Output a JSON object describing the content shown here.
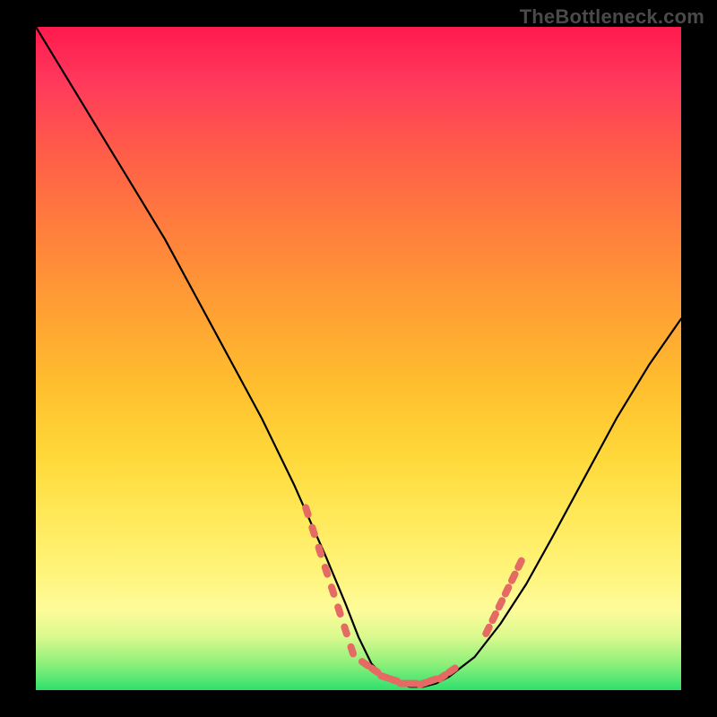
{
  "watermark": "TheBottleneck.com",
  "chart_data": {
    "type": "line",
    "title": "",
    "xlabel": "",
    "ylabel": "",
    "xlim": [
      0,
      100
    ],
    "ylim": [
      0,
      100
    ],
    "grid": false,
    "legend": false,
    "series": [
      {
        "name": "bottleneck-curve",
        "color": "#000000",
        "x": [
          0,
          5,
          10,
          15,
          20,
          25,
          30,
          35,
          40,
          45,
          48,
          50,
          52,
          54,
          56,
          58,
          60,
          62,
          64,
          68,
          72,
          76,
          80,
          85,
          90,
          95,
          100
        ],
        "y": [
          100,
          92,
          84,
          76,
          68,
          59,
          50,
          41,
          31,
          20,
          13,
          8,
          4,
          2,
          1,
          0.5,
          0.5,
          1,
          2,
          5,
          10,
          16,
          23,
          32,
          41,
          49,
          56
        ]
      },
      {
        "name": "highlight-band-left",
        "color": "#e46a63",
        "style": "dotted",
        "x": [
          42,
          43,
          44,
          45,
          46,
          47,
          48,
          49
        ],
        "y": [
          27,
          24,
          21,
          18,
          15,
          12,
          9,
          6
        ]
      },
      {
        "name": "highlight-band-bottom",
        "color": "#e46a63",
        "style": "dotted",
        "x": [
          51,
          52.5,
          54,
          55.5,
          57,
          58.5,
          60,
          61.5,
          63,
          64.5
        ],
        "y": [
          4,
          3,
          2,
          1.5,
          1,
          1,
          1,
          1.5,
          2,
          3
        ]
      },
      {
        "name": "highlight-band-right",
        "color": "#e46a63",
        "style": "dotted",
        "x": [
          70,
          71,
          72,
          73,
          74,
          75
        ],
        "y": [
          9,
          11,
          13,
          15,
          17,
          19
        ]
      }
    ],
    "background_gradient": {
      "top": "#ff1a4d",
      "mid": "#ffd93a",
      "bottom": "#2fe06e"
    }
  }
}
